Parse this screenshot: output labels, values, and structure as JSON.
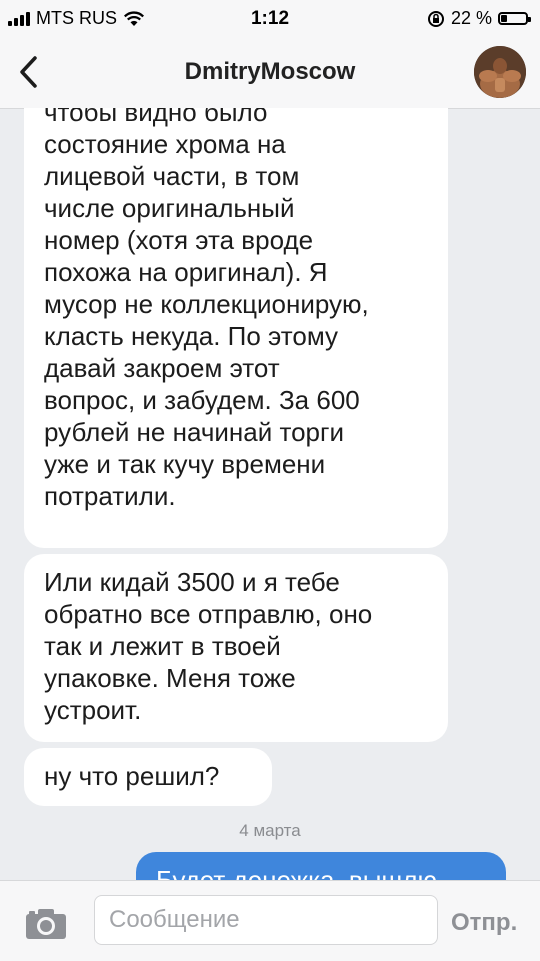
{
  "status_bar": {
    "carrier": "MTS RUS",
    "time": "1:12",
    "battery_percent": "22 %",
    "battery_level": 0.22
  },
  "header": {
    "title": "DmitryMoscow",
    "back_icon": "chevron-left-icon",
    "avatar_icon": "avatar"
  },
  "messages": [
    {
      "direction": "incoming",
      "text": "если хочешь отправить,\nчтобы видно было\nсостояние хрома на\nлицевой части, в том\nчисле оригинальный\nномер (хотя эта вроде\nпохожа на оригинал). Я\nмусор не коллекционирую,\nкласть некуда. По этому\nдавай закроем этот\nвопрос, и забудем. За 600\nрублей не начинай торги\nуже и так кучу времени\nпотратили."
    },
    {
      "direction": "incoming",
      "text": "Или кидай 3500 и я тебе\nобратно все отправлю, оно\nтак и лежит в твоей\nупаковке. Меня тоже\nустроит."
    },
    {
      "direction": "incoming",
      "text": "ну что решил?"
    }
  ],
  "date_separator": "4 марта",
  "outgoing_partial": "Будет денежка, вышлю",
  "input_bar": {
    "placeholder": "Сообщение",
    "send_label": "Отпр.",
    "camera_icon": "camera-icon"
  },
  "colors": {
    "background": "#ebedf0",
    "incoming_bubble": "#ffffff",
    "outgoing_bubble": "#3f86dc",
    "bar": "#f7f7f8"
  }
}
